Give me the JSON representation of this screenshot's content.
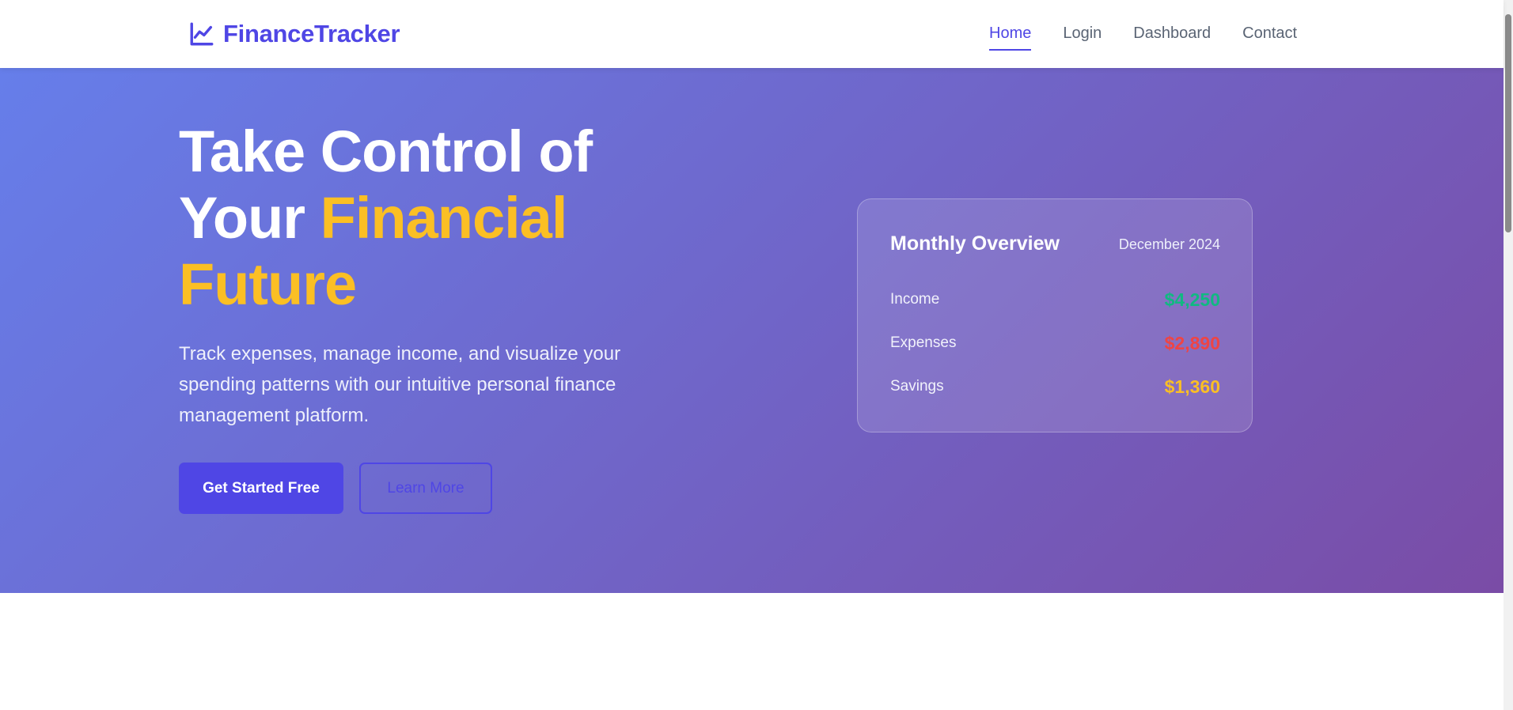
{
  "brand": {
    "name": "FinanceTracker",
    "icon": "chart-line-icon"
  },
  "nav": {
    "items": [
      {
        "label": "Home",
        "active": true
      },
      {
        "label": "Login",
        "active": false
      },
      {
        "label": "Dashboard",
        "active": false
      },
      {
        "label": "Contact",
        "active": false
      }
    ]
  },
  "hero": {
    "title_line1": "Take Control of",
    "title_line2_plain": "Your ",
    "title_line2_accent": "Financial",
    "title_line3_accent": "Future",
    "subtitle": "Track expenses, manage income, and visualize your spending patterns with our intuitive personal finance management platform.",
    "primary_button": "Get Started Free",
    "secondary_button": "Learn More"
  },
  "overview": {
    "title": "Monthly Overview",
    "date": "December 2024",
    "rows": [
      {
        "label": "Income",
        "value": "$4,250"
      },
      {
        "label": "Expenses",
        "value": "$2,890"
      },
      {
        "label": "Savings",
        "value": "$1,360"
      }
    ]
  },
  "colors": {
    "brand": "#4f46e5",
    "accent": "#fbbf24",
    "income": "#10b981",
    "expenses": "#ef4444",
    "savings": "#fbbf24",
    "gradient_start": "#667eea",
    "gradient_end": "#7a4ca6"
  }
}
